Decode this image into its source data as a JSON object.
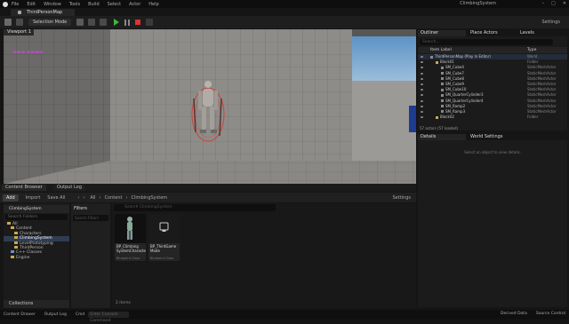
{
  "menubar": {
    "items": [
      "File",
      "Edit",
      "Window",
      "Tools",
      "Build",
      "Select",
      "Actor",
      "Help"
    ],
    "project_title": "ClimbingSystem"
  },
  "map_tab": {
    "label": "ThirdPersonMap"
  },
  "toolbar": {
    "selection_mode": "Selection Mode",
    "settings": "Settings"
  },
  "viewport": {
    "tab": "Viewport 1"
  },
  "bottom_tabs": {
    "content_browser": "Content Browser",
    "output_log": "Output Log"
  },
  "content_browser": {
    "add": "Add",
    "import": "Import",
    "save_all": "Save All",
    "breadcrumb": [
      "All",
      "Content",
      "ClimbingSystem"
    ],
    "settings": "Settings",
    "project": "ClimbingSystem",
    "search_folders": "Search Folders",
    "tree": [
      "All",
      "Content",
      "Characters",
      "ClimbingSystem",
      "LevelPrototyping",
      "ThirdPerson",
      "C++ Classes",
      "Engine"
    ],
    "tree_selected": 3,
    "filters": "Filters",
    "filters_search": "Search Filters",
    "search_placeholder": "Search ClimbingSystem",
    "assets": [
      {
        "name": "BP_Climbing SystemCharacter",
        "type": "Blueprint Class"
      },
      {
        "name": "BP_ThirdGame Mode",
        "type": "Blueprint Class"
      }
    ],
    "item_count": "2 items",
    "collections": "Collections"
  },
  "outliner": {
    "tabs": [
      "Outliner",
      "Place Actors",
      "Levels"
    ],
    "search_placeholder": "Search...",
    "col_label": "Item Label",
    "col_type": "Type",
    "rows": [
      {
        "name": "ThirdPersonMap (Play In Editor)",
        "type": "World",
        "indent": 0,
        "folder": false
      },
      {
        "name": "Block01",
        "type": "Folder",
        "indent": 1,
        "folder": true
      },
      {
        "name": "SM_Cube4",
        "type": "StaticMeshActor",
        "indent": 2,
        "folder": false
      },
      {
        "name": "SM_Cube7",
        "type": "StaticMeshActor",
        "indent": 2,
        "folder": false
      },
      {
        "name": "SM_Cube8",
        "type": "StaticMeshActor",
        "indent": 2,
        "folder": false
      },
      {
        "name": "SM_Cube9",
        "type": "StaticMeshActor",
        "indent": 2,
        "folder": false
      },
      {
        "name": "SM_Cube10",
        "type": "StaticMeshActor",
        "indent": 2,
        "folder": false
      },
      {
        "name": "SM_QuarterCylinder3",
        "type": "StaticMeshActor",
        "indent": 2,
        "folder": false
      },
      {
        "name": "SM_QuarterCylinder4",
        "type": "StaticMeshActor",
        "indent": 2,
        "folder": false
      },
      {
        "name": "SM_Ramp2",
        "type": "StaticMeshActor",
        "indent": 2,
        "folder": false
      },
      {
        "name": "SM_Ramp3",
        "type": "StaticMeshActor",
        "indent": 2,
        "folder": false
      },
      {
        "name": "Block02",
        "type": "Folder",
        "indent": 1,
        "folder": true
      }
    ],
    "count": "57 actors (57 loaded)"
  },
  "details": {
    "tabs": [
      "Details",
      "World Settings"
    ],
    "message": "Select an object to view details."
  },
  "statusbar": {
    "content_drawer": "Content Drawer",
    "output_log": "Output Log",
    "cmd": "Cmd",
    "cmd_placeholder": "Enter Console Command",
    "derived_data": "Derived Data",
    "source_control": "Source Control"
  }
}
